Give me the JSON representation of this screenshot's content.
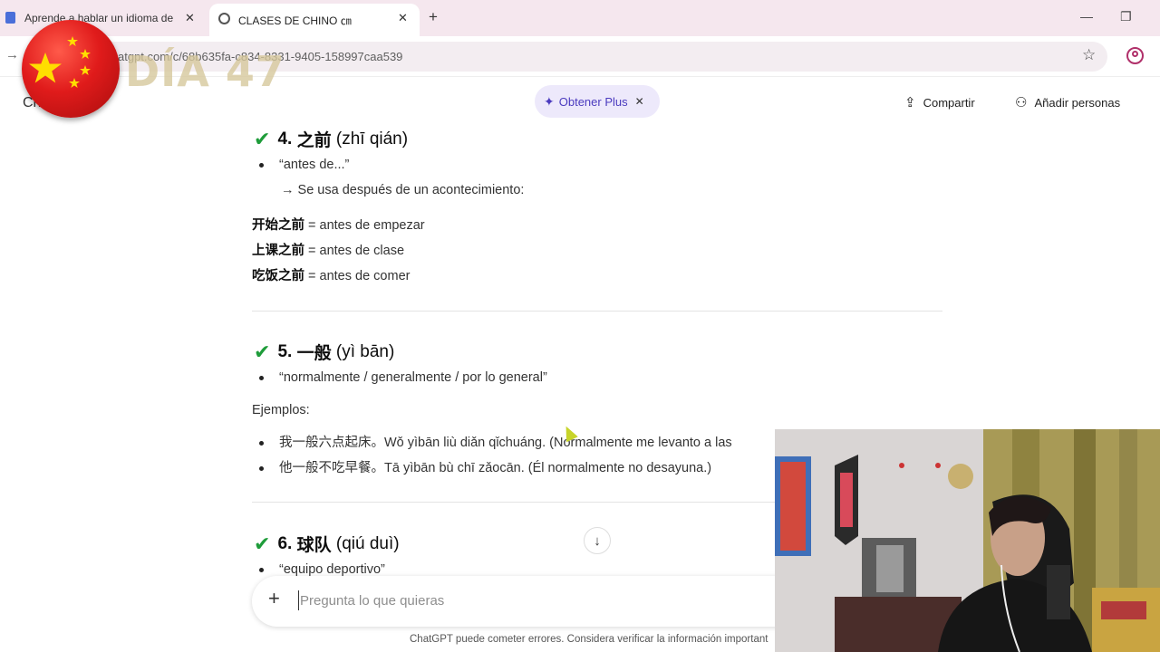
{
  "browser": {
    "tabs": [
      {
        "title": "Aprende a hablar un idioma de"
      },
      {
        "title": "CLASES DE CHINO ㎝"
      }
    ],
    "new_tab": "+",
    "close": "✕",
    "minimize": "—",
    "restore": "❐",
    "url": "atgpt.com/c/68b635fa-c834-8331-9405-158997caa539"
  },
  "overlay": {
    "day_label": "DÍA 47"
  },
  "header": {
    "model_partial": "Ch",
    "get_plus": "Obtener Plus",
    "share": "Compartir",
    "add_people": "Añadir personas"
  },
  "sections": [
    {
      "num": "4.",
      "hanzi": "之前",
      "pinyin": "(zhī qián)",
      "meaning": "“antes de...”",
      "note": "→ Se usa después de un acontecimiento:",
      "examples": [
        {
          "zh": "开始之前",
          "es": " = antes de empezar"
        },
        {
          "zh": "上课之前",
          "es": " = antes de clase"
        },
        {
          "zh": "吃饭之前",
          "es": " = antes de comer"
        }
      ]
    },
    {
      "num": "5.",
      "hanzi": "一般",
      "pinyin": "(yì bān)",
      "meaning": "“normalmente / generalmente / por lo general”",
      "examples_label": "Ejemplos:",
      "examples": [
        "我一般六点起床。Wǒ yìbān liù diǎn qǐchuáng. (Normalmente me levanto a las",
        "他一般不吃早餐。Tā yìbān bù chī zǎocān. (Él normalmente no desayuna.)"
      ]
    },
    {
      "num": "6.",
      "hanzi": "球队",
      "pinyin": "(qiú duì)",
      "meaning": "“equipo deportivo”"
    }
  ],
  "composer": {
    "placeholder": "Pregunta lo que quieras"
  },
  "disclaimer": "ChatGPT puede cometer errores. Considera verificar la información important",
  "colors": {
    "check": "#1e9c3a",
    "flag_red": "#e01b1b",
    "flag_star": "#ffde00",
    "plus_pill": "#ede9fb",
    "tabstrip": "#f5e7ee"
  },
  "icons": [
    "check-icon",
    "star-icon",
    "share-icon",
    "add-person-icon",
    "sparkle-icon",
    "scroll-down-icon",
    "plus-icon"
  ]
}
